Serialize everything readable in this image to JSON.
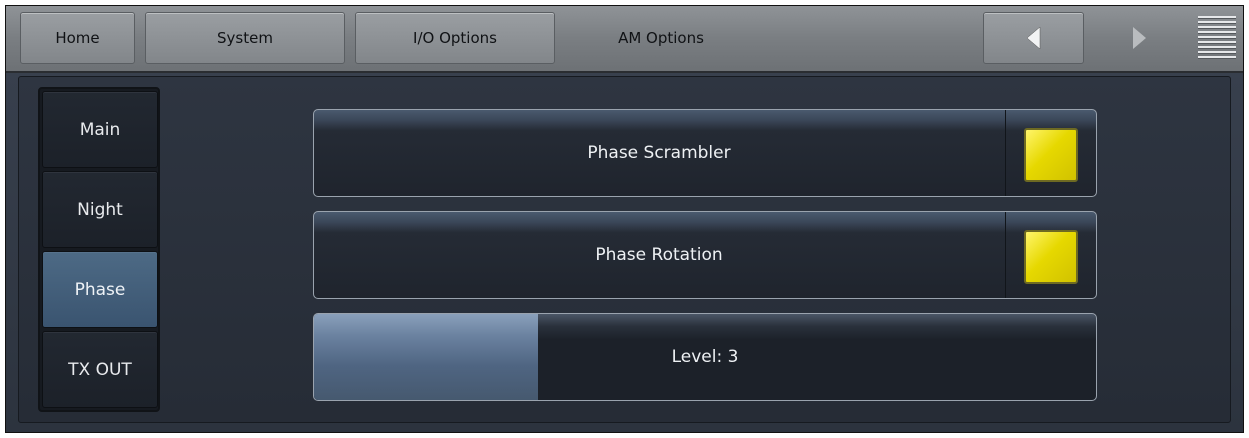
{
  "topbar": {
    "tabs": [
      {
        "label": "Home"
      },
      {
        "label": "System"
      },
      {
        "label": "I/O Options"
      },
      {
        "label": "AM Options"
      }
    ]
  },
  "sidebar": {
    "items": [
      {
        "label": "Main",
        "active": false
      },
      {
        "label": "Night",
        "active": false
      },
      {
        "label": "Phase",
        "active": true
      },
      {
        "label": "TX OUT",
        "active": false
      }
    ]
  },
  "main": {
    "controls": [
      {
        "label": "Phase Scrambler",
        "enabled": true
      },
      {
        "label": "Phase Rotation",
        "enabled": true
      }
    ],
    "level": {
      "label": "Level: 3",
      "fraction": 0.286
    }
  },
  "colors": {
    "indicator_on": "#e6d800",
    "active_tab": "#3a5470",
    "accent_slider": "#6b82a0"
  },
  "icons": [
    "arrow-left-icon",
    "arrow-right-icon",
    "menu-lines-icon"
  ]
}
